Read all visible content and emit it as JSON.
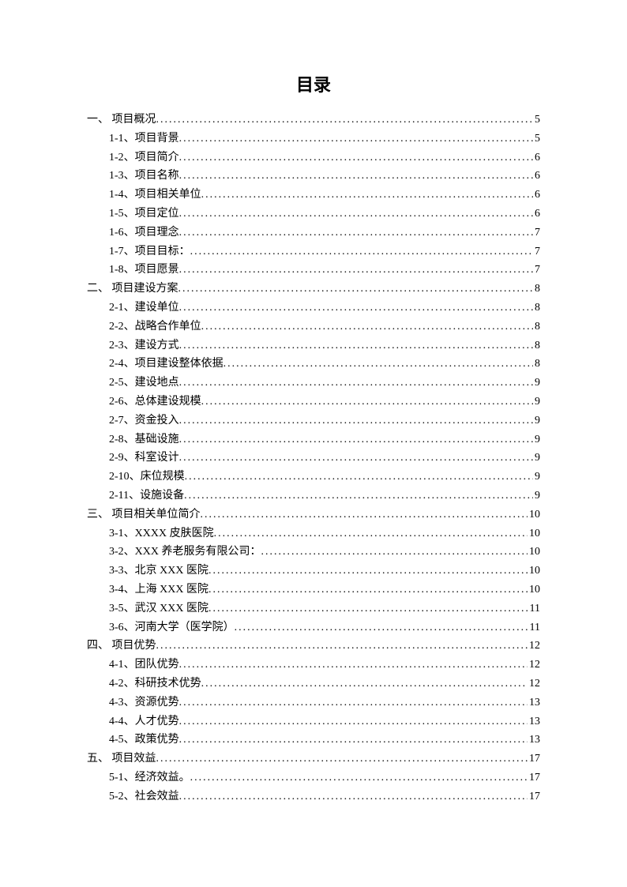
{
  "title": "目录",
  "entries": [
    {
      "level": 1,
      "num": "一、",
      "text": "项目概况",
      "page": "5"
    },
    {
      "level": 2,
      "num": "1-1、",
      "text": "项目背景",
      "page": "5"
    },
    {
      "level": 2,
      "num": "1-2、",
      "text": "项目简介",
      "page": "6"
    },
    {
      "level": 2,
      "num": "1-3、",
      "text": "项目名称",
      "page": "6"
    },
    {
      "level": 2,
      "num": "1-4、",
      "text": "项目相关单位",
      "page": "6"
    },
    {
      "level": 2,
      "num": "1-5、",
      "text": "项目定位",
      "page": "6"
    },
    {
      "level": 2,
      "num": "1-6、",
      "text": "项目理念",
      "page": "7"
    },
    {
      "level": 2,
      "num": "1-7、",
      "text": "项目目标：",
      "page": "7"
    },
    {
      "level": 2,
      "num": "1-8、",
      "text": "项目愿景",
      "page": "7"
    },
    {
      "level": 1,
      "num": "二、",
      "text": "项目建设方案",
      "page": "8"
    },
    {
      "level": 2,
      "num": "2-1、",
      "text": "建设单位",
      "page": "8"
    },
    {
      "level": 2,
      "num": "2-2、",
      "text": "战略合作单位",
      "page": "8"
    },
    {
      "level": 2,
      "num": "2-3、",
      "text": "建设方式",
      "page": "8"
    },
    {
      "level": 2,
      "num": "2-4、",
      "text": "项目建设整体依据",
      "page": "8"
    },
    {
      "level": 2,
      "num": "2-5、",
      "text": "建设地点",
      "page": "9"
    },
    {
      "level": 2,
      "num": "2-6、",
      "text": "总体建设规模",
      "page": "9"
    },
    {
      "level": 2,
      "num": "2-7、",
      "text": "资金投入",
      "page": "9"
    },
    {
      "level": 2,
      "num": "2-8、",
      "text": "基础设施",
      "page": "9"
    },
    {
      "level": 2,
      "num": "2-9、",
      "text": "科室设计",
      "page": "9"
    },
    {
      "level": 2,
      "num": "2-10、",
      "text": "床位规模",
      "page": "9"
    },
    {
      "level": 2,
      "num": "2-11、",
      "text": "设施设备",
      "page": "9"
    },
    {
      "level": 1,
      "num": "三、",
      "text": "项目相关单位简介",
      "page": "10"
    },
    {
      "level": 2,
      "num": "3-1、",
      "text": "XXXX 皮肤医院",
      "page": "10"
    },
    {
      "level": 2,
      "num": "3-2、",
      "text": "XXX 养老服务有限公司：",
      "page": "10"
    },
    {
      "level": 2,
      "num": "3-3、",
      "text": "北京 XXX 医院",
      "page": "10"
    },
    {
      "level": 2,
      "num": "3-4、",
      "text": "上海 XXX 医院",
      "page": "10"
    },
    {
      "level": 2,
      "num": "3-5、",
      "text": "武汉 XXX 医院",
      "page": "11"
    },
    {
      "level": 2,
      "num": "3-6、",
      "text": "河南大学（医学院）",
      "page": "11"
    },
    {
      "level": 1,
      "num": "四、",
      "text": "项目优势",
      "page": "12"
    },
    {
      "level": 2,
      "num": "4-1、",
      "text": "团队优势",
      "page": "12"
    },
    {
      "level": 2,
      "num": "4-2、",
      "text": "科研技术优势",
      "page": "12"
    },
    {
      "level": 2,
      "num": "4-3、",
      "text": "资源优势",
      "page": "13"
    },
    {
      "level": 2,
      "num": "4-4、",
      "text": "人才优势",
      "page": "13"
    },
    {
      "level": 2,
      "num": "4-5、",
      "text": "政策优势",
      "page": "13"
    },
    {
      "level": 1,
      "num": "五、",
      "text": "项目效益",
      "page": "17"
    },
    {
      "level": 2,
      "num": "5-1、",
      "text": "经济效益。",
      "page": "17"
    },
    {
      "level": 2,
      "num": "5-2、",
      "text": "社会效益",
      "page": "17"
    }
  ]
}
